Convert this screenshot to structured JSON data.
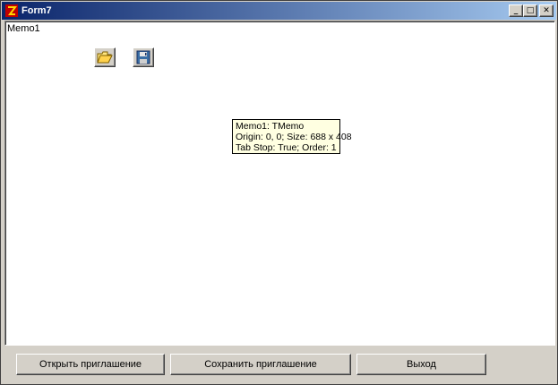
{
  "window": {
    "title": "Form7",
    "caption_minimize": "_",
    "caption_maximize": "□",
    "caption_close": "✕"
  },
  "memo": {
    "text": "Memo1"
  },
  "tools": {
    "open_icon": "folder-open-icon",
    "save_icon": "floppy-disk-icon"
  },
  "hint": {
    "line1": "Memo1: TMemo",
    "line2": "Origin: 0, 0; Size: 688 x 408",
    "line3": "Tab Stop: True; Order: 1"
  },
  "buttons": {
    "open_label": "Открыть приглашение",
    "save_label": "Сохранить приглашение",
    "exit_label": "Выход"
  },
  "colors": {
    "title_start": "#0a246a",
    "title_end": "#a6caf0",
    "face": "#d4d0c8",
    "hint_bg": "#ffffe1"
  }
}
